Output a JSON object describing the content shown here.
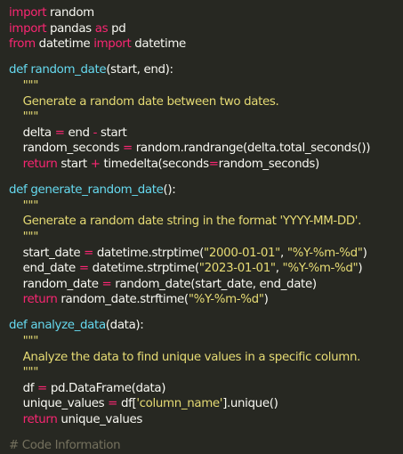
{
  "code": {
    "lines": [
      [
        {
          "t": "import",
          "c": "kw"
        },
        {
          "t": " random",
          "c": "txt"
        }
      ],
      [
        {
          "t": "import",
          "c": "kw"
        },
        {
          "t": " pandas ",
          "c": "txt"
        },
        {
          "t": "as",
          "c": "kw"
        },
        {
          "t": " pd",
          "c": "txt"
        }
      ],
      [
        {
          "t": "from",
          "c": "kw"
        },
        {
          "t": " datetime ",
          "c": "txt"
        },
        {
          "t": "import",
          "c": "kw"
        },
        {
          "t": " datetime",
          "c": "txt"
        }
      ],
      [],
      [
        {
          "t": "def",
          "c": "fn"
        },
        {
          "t": " ",
          "c": "txt"
        },
        {
          "t": "random_date",
          "c": "fn"
        },
        {
          "t": "(start, end):",
          "c": "txt"
        }
      ],
      [
        {
          "t": "    \"\"\"",
          "c": "str"
        }
      ],
      [
        {
          "t": "    Generate a random date between two dates.",
          "c": "str"
        }
      ],
      [
        {
          "t": "    \"\"\"",
          "c": "str"
        }
      ],
      [
        {
          "t": "    delta ",
          "c": "txt"
        },
        {
          "t": "=",
          "c": "kw"
        },
        {
          "t": " end ",
          "c": "txt"
        },
        {
          "t": "-",
          "c": "kw"
        },
        {
          "t": " start",
          "c": "txt"
        }
      ],
      [
        {
          "t": "    random_seconds ",
          "c": "txt"
        },
        {
          "t": "=",
          "c": "kw"
        },
        {
          "t": " random.randrange(delta.total_seconds())",
          "c": "txt"
        }
      ],
      [
        {
          "t": "    ",
          "c": "txt"
        },
        {
          "t": "return",
          "c": "kw"
        },
        {
          "t": " start ",
          "c": "txt"
        },
        {
          "t": "+",
          "c": "kw"
        },
        {
          "t": " timedelta(seconds",
          "c": "txt"
        },
        {
          "t": "=",
          "c": "kw"
        },
        {
          "t": "random_seconds)",
          "c": "txt"
        }
      ],
      [],
      [
        {
          "t": "def",
          "c": "fn"
        },
        {
          "t": " ",
          "c": "txt"
        },
        {
          "t": "generate_random_date",
          "c": "fn"
        },
        {
          "t": "():",
          "c": "txt"
        }
      ],
      [
        {
          "t": "    \"\"\"",
          "c": "str"
        }
      ],
      [
        {
          "t": "    Generate a random date string in the format 'YYYY-MM-DD'.",
          "c": "str"
        }
      ],
      [
        {
          "t": "    \"\"\"",
          "c": "str"
        }
      ],
      [
        {
          "t": "    start_date ",
          "c": "txt"
        },
        {
          "t": "=",
          "c": "kw"
        },
        {
          "t": " datetime.strptime(",
          "c": "txt"
        },
        {
          "t": "\"2000-01-01\"",
          "c": "str"
        },
        {
          "t": ", ",
          "c": "txt"
        },
        {
          "t": "\"%Y-%m-%d\"",
          "c": "str"
        },
        {
          "t": ")",
          "c": "txt"
        }
      ],
      [
        {
          "t": "    end_date ",
          "c": "txt"
        },
        {
          "t": "=",
          "c": "kw"
        },
        {
          "t": " datetime.strptime(",
          "c": "txt"
        },
        {
          "t": "\"2023-01-01\"",
          "c": "str"
        },
        {
          "t": ", ",
          "c": "txt"
        },
        {
          "t": "\"%Y-%m-%d\"",
          "c": "str"
        },
        {
          "t": ")",
          "c": "txt"
        }
      ],
      [
        {
          "t": "    random_date ",
          "c": "txt"
        },
        {
          "t": "=",
          "c": "kw"
        },
        {
          "t": " random_date(start_date, end_date)",
          "c": "txt"
        }
      ],
      [
        {
          "t": "    ",
          "c": "txt"
        },
        {
          "t": "return",
          "c": "kw"
        },
        {
          "t": " random_date.strftime(",
          "c": "txt"
        },
        {
          "t": "\"%Y-%m-%d\"",
          "c": "str"
        },
        {
          "t": ")",
          "c": "txt"
        }
      ],
      [],
      [
        {
          "t": "def",
          "c": "fn"
        },
        {
          "t": " ",
          "c": "txt"
        },
        {
          "t": "analyze_data",
          "c": "fn"
        },
        {
          "t": "(data):",
          "c": "txt"
        }
      ],
      [
        {
          "t": "    \"\"\"",
          "c": "str"
        }
      ],
      [
        {
          "t": "    Analyze the data to find unique values in a specific column.",
          "c": "str"
        }
      ],
      [
        {
          "t": "    \"\"\"",
          "c": "str"
        }
      ],
      [
        {
          "t": "    df ",
          "c": "txt"
        },
        {
          "t": "=",
          "c": "kw"
        },
        {
          "t": " pd.DataFrame(data)",
          "c": "txt"
        }
      ],
      [
        {
          "t": "    unique_values ",
          "c": "txt"
        },
        {
          "t": "=",
          "c": "kw"
        },
        {
          "t": " df[",
          "c": "txt"
        },
        {
          "t": "'column_name'",
          "c": "str"
        },
        {
          "t": "].unique()",
          "c": "txt"
        }
      ],
      [
        {
          "t": "    ",
          "c": "txt"
        },
        {
          "t": "return",
          "c": "kw"
        },
        {
          "t": " unique_values",
          "c": "txt"
        }
      ],
      [],
      [
        {
          "t": "# Code Information",
          "c": "cmt"
        }
      ]
    ]
  },
  "colors": {
    "background": "#272822",
    "keyword": "#f92672",
    "function": "#66d9ef",
    "string": "#e6db74",
    "comment": "#75715e",
    "text": "#f8f8f2"
  }
}
